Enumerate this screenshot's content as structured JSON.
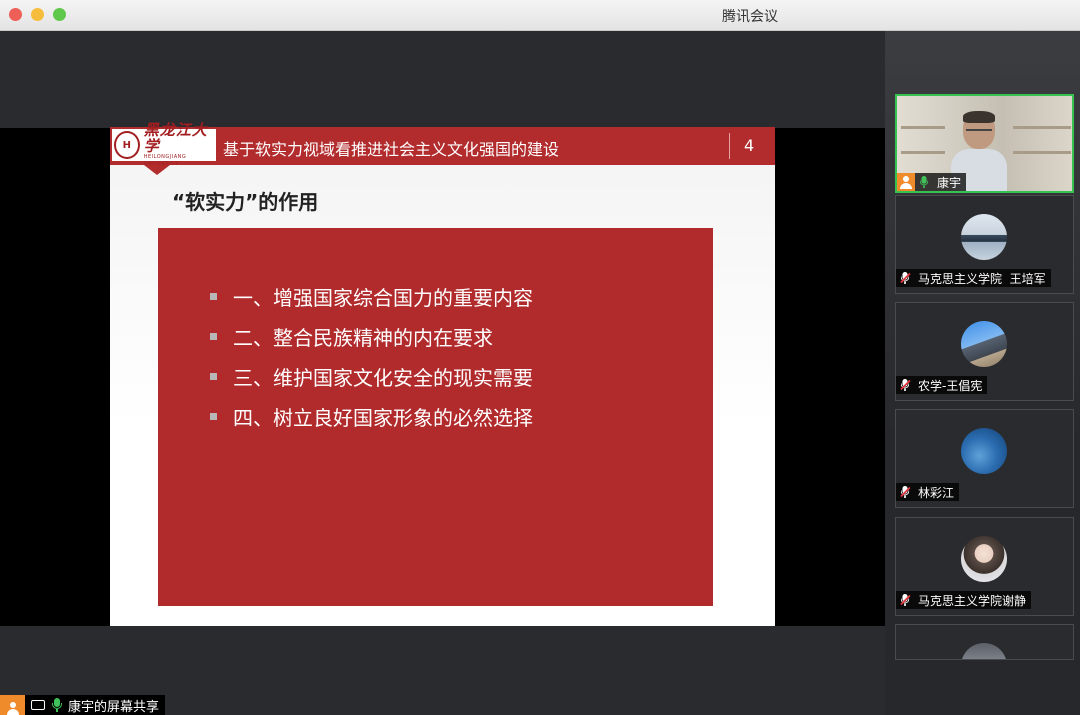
{
  "window": {
    "title": "腾讯会议"
  },
  "slide": {
    "logo_text_cn": "黑龙江大学",
    "logo_text_en": "HEILONGJIANG UNIVERSITY",
    "header_title": "基于软实力视域看推进社会主义文化强国的建设",
    "page_number": "4",
    "section_title": "“软实力”的作用",
    "bullets": [
      "一、增强国家综合国力的重要内容",
      "二、整合民族精神的内在要求",
      "三、维护国家文化安全的现实需要",
      "四、树立良好国家形象的必然选择"
    ]
  },
  "share_indicator": {
    "label": "康宇的屏幕共享"
  },
  "participants": [
    {
      "name": "康宇",
      "mic": "on",
      "video": true
    },
    {
      "name": "马克思主义学院  王培军",
      "mic": "muted",
      "avatar": "city-icon"
    },
    {
      "name": "农学-王倡宪",
      "mic": "muted",
      "avatar": "road-icon"
    },
    {
      "name": "林彩江",
      "mic": "muted",
      "avatar": "globe-icon"
    },
    {
      "name": "马克思主义学院谢静",
      "mic": "muted",
      "avatar": "portrait-icon"
    }
  ],
  "colors": {
    "slide_red": "#b22c2e",
    "active_border": "#36c251",
    "mic_on": "#40c25a",
    "mute_slash": "#e5363c",
    "avatar_orange": "#f08b2c"
  }
}
